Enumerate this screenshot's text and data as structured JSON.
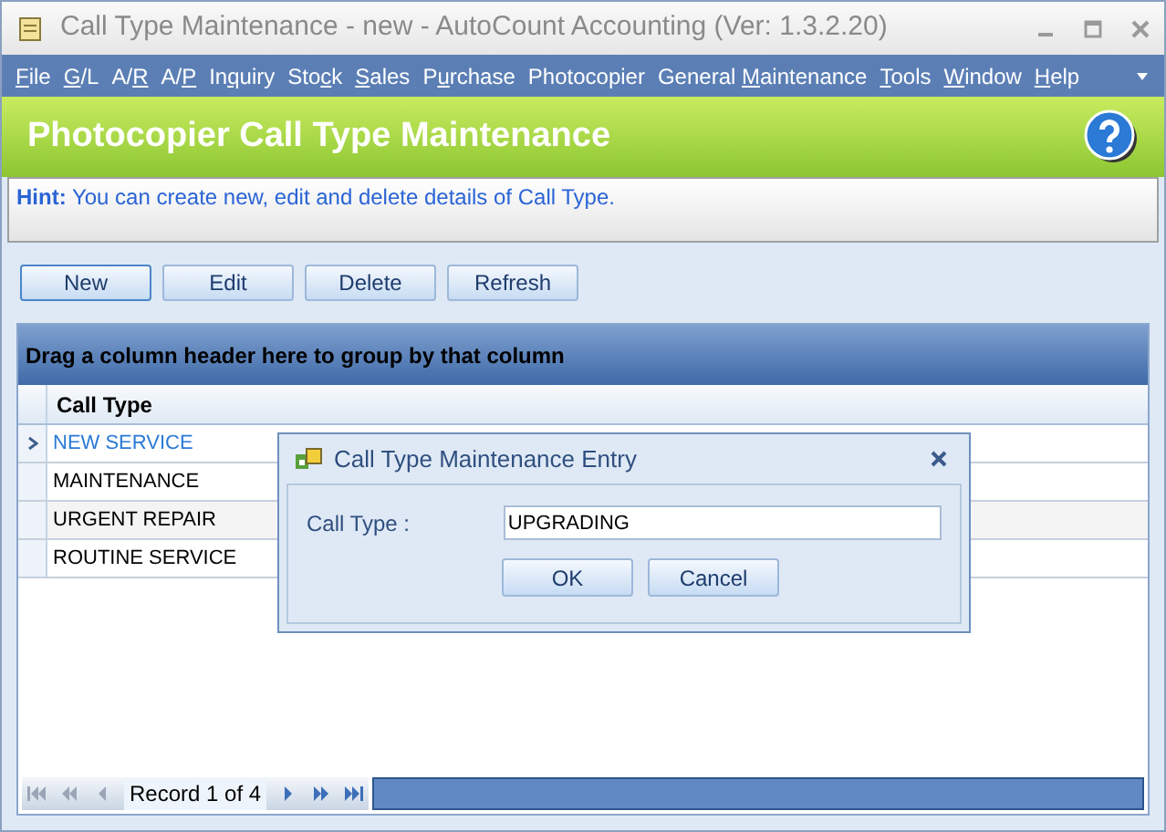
{
  "window": {
    "title": "Call Type Maintenance - new - AutoCount Accounting (Ver: 1.3.2.20)"
  },
  "menu": [
    {
      "key": "F",
      "after": "ile"
    },
    {
      "key": "G",
      "after": "/L"
    },
    {
      "before": "A/",
      "key": "R"
    },
    {
      "before": "A/",
      "key": "P"
    },
    {
      "before": "In",
      "key": "q",
      "after": "uiry"
    },
    {
      "before": "Sto",
      "key": "c",
      "after": "k"
    },
    {
      "key": "S",
      "after": "ales"
    },
    {
      "before": "P",
      "key": "u",
      "after": "rchase"
    },
    {
      "before": "Photocopier"
    },
    {
      "before": "General ",
      "key": "M",
      "after": "aintenance"
    },
    {
      "key": "T",
      "after": "ools"
    },
    {
      "key": "W",
      "after": "indow"
    },
    {
      "key": "H",
      "after": "elp"
    }
  ],
  "header": {
    "title": "Photocopier Call Type Maintenance"
  },
  "hint": {
    "label": "Hint:",
    "text": "You can create new, edit and delete details of Call Type."
  },
  "toolbar": [
    {
      "label": "New",
      "selected": true
    },
    {
      "label": "Edit",
      "selected": false
    },
    {
      "label": "Delete",
      "selected": false
    },
    {
      "label": "Refresh",
      "selected": false
    }
  ],
  "grid": {
    "group_panel": "Drag a column header here to group by that column",
    "columns": [
      "Call Type"
    ],
    "rows": [
      {
        "call_type": "NEW SERVICE",
        "selected": true
      },
      {
        "call_type": "MAINTENANCE",
        "selected": false
      },
      {
        "call_type": "URGENT REPAIR",
        "selected": false
      },
      {
        "call_type": "ROUTINE SERVICE",
        "selected": false
      }
    ],
    "navigator": {
      "record": "Record 1 of 4"
    }
  },
  "dialog": {
    "title": "Call Type Maintenance Entry",
    "field_label": "Call Type :",
    "value": "UPGRADING",
    "buttons": [
      "OK",
      "Cancel"
    ]
  }
}
